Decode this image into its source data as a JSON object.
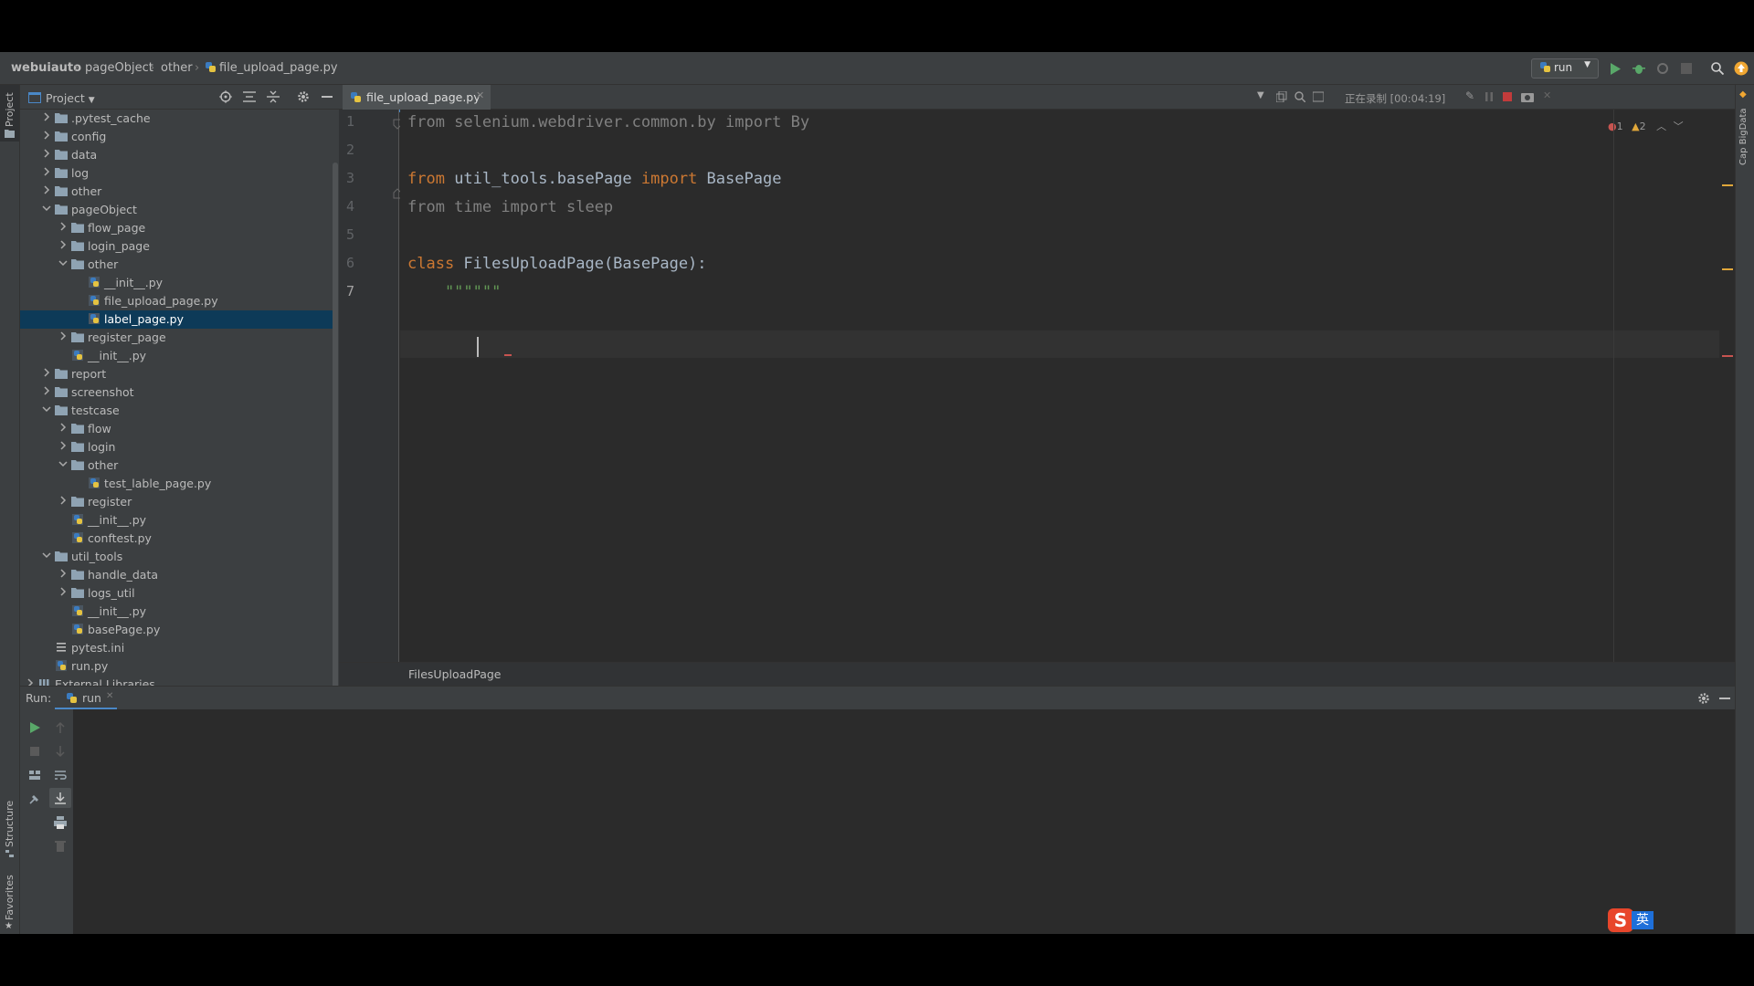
{
  "navbar": {
    "breadcrumbs": [
      "webuiauto",
      "pageObject",
      "other",
      "file_upload_page.py"
    ],
    "run_config": "run"
  },
  "project_panel": {
    "title": "Project",
    "tree": [
      {
        "label": ".pytest_cache",
        "depth": 0,
        "kind": "folder",
        "expanded": false
      },
      {
        "label": "config",
        "depth": 0,
        "kind": "folder",
        "expanded": false
      },
      {
        "label": "data",
        "depth": 0,
        "kind": "folder",
        "expanded": false
      },
      {
        "label": "log",
        "depth": 0,
        "kind": "folder",
        "expanded": false
      },
      {
        "label": "other",
        "depth": 0,
        "kind": "folder",
        "expanded": false
      },
      {
        "label": "pageObject",
        "depth": 0,
        "kind": "folder",
        "expanded": true
      },
      {
        "label": "flow_page",
        "depth": 1,
        "kind": "folder",
        "expanded": false
      },
      {
        "label": "login_page",
        "depth": 1,
        "kind": "folder",
        "expanded": false
      },
      {
        "label": "other",
        "depth": 1,
        "kind": "folder",
        "expanded": true
      },
      {
        "label": "__init__.py",
        "depth": 2,
        "kind": "py"
      },
      {
        "label": "file_upload_page.py",
        "depth": 2,
        "kind": "py"
      },
      {
        "label": "label_page.py",
        "depth": 2,
        "kind": "py",
        "selected": true
      },
      {
        "label": "register_page",
        "depth": 1,
        "kind": "folder",
        "expanded": false
      },
      {
        "label": "__init__.py",
        "depth": 1,
        "kind": "py"
      },
      {
        "label": "report",
        "depth": 0,
        "kind": "folder",
        "expanded": false
      },
      {
        "label": "screenshot",
        "depth": 0,
        "kind": "folder",
        "expanded": false
      },
      {
        "label": "testcase",
        "depth": 0,
        "kind": "folder",
        "expanded": true
      },
      {
        "label": "flow",
        "depth": 1,
        "kind": "folder",
        "expanded": false
      },
      {
        "label": "login",
        "depth": 1,
        "kind": "folder",
        "expanded": false
      },
      {
        "label": "other",
        "depth": 1,
        "kind": "folder",
        "expanded": true
      },
      {
        "label": "test_lable_page.py",
        "depth": 2,
        "kind": "py"
      },
      {
        "label": "register",
        "depth": 1,
        "kind": "folder",
        "expanded": false
      },
      {
        "label": "__init__.py",
        "depth": 1,
        "kind": "py"
      },
      {
        "label": "conftest.py",
        "depth": 1,
        "kind": "py"
      },
      {
        "label": "util_tools",
        "depth": 0,
        "kind": "folder",
        "expanded": true
      },
      {
        "label": "handle_data",
        "depth": 1,
        "kind": "folder",
        "expanded": false
      },
      {
        "label": "logs_util",
        "depth": 1,
        "kind": "folder",
        "expanded": false
      },
      {
        "label": "__init__.py",
        "depth": 1,
        "kind": "py"
      },
      {
        "label": "basePage.py",
        "depth": 1,
        "kind": "py"
      },
      {
        "label": "pytest.ini",
        "depth": 0,
        "kind": "ini"
      },
      {
        "label": "run.py",
        "depth": 0,
        "kind": "py"
      },
      {
        "label": "External Libraries",
        "depth": -1,
        "kind": "lib",
        "expanded": false
      }
    ]
  },
  "editor": {
    "tab_label": "file_upload_page.py",
    "recording_label": "正在录制 [00:04:19]",
    "error_count": "1",
    "warning_count": "2",
    "line_numbers": [
      "1",
      "2",
      "3",
      "4",
      "5",
      "6",
      "7"
    ],
    "lines": [
      {
        "tokens": [
          {
            "t": "from selenium.webdriver.common.by import By",
            "c": "dim"
          }
        ]
      },
      {
        "tokens": []
      },
      {
        "tokens": [
          {
            "t": "from ",
            "c": "kw"
          },
          {
            "t": "util_tools.basePage ",
            "c": ""
          },
          {
            "t": "import ",
            "c": "kw"
          },
          {
            "t": "BasePage",
            "c": ""
          }
        ]
      },
      {
        "tokens": [
          {
            "t": "from time import sleep",
            "c": "dim"
          }
        ]
      },
      {
        "tokens": []
      },
      {
        "tokens": [
          {
            "t": "class ",
            "c": "kw"
          },
          {
            "t": "FilesUploadPage(BasePage):",
            "c": ""
          }
        ]
      },
      {
        "tokens": [
          {
            "t": "    \"\"\"\"\"\"",
            "c": "str"
          }
        ]
      }
    ],
    "structure_crumb": "FilesUploadPage"
  },
  "run_panel": {
    "label": "Run:",
    "tab_label": "run"
  },
  "side_stripes": {
    "left_top": "Project",
    "left_structure": "Structure",
    "left_favorites": "Favorites",
    "right_top": "Cap BigData"
  },
  "ime": {
    "label": "英"
  },
  "colors": {
    "keyword": "#cc7832",
    "string": "#629755",
    "selection": "#0d3a58",
    "accent": "#4a88c7"
  }
}
